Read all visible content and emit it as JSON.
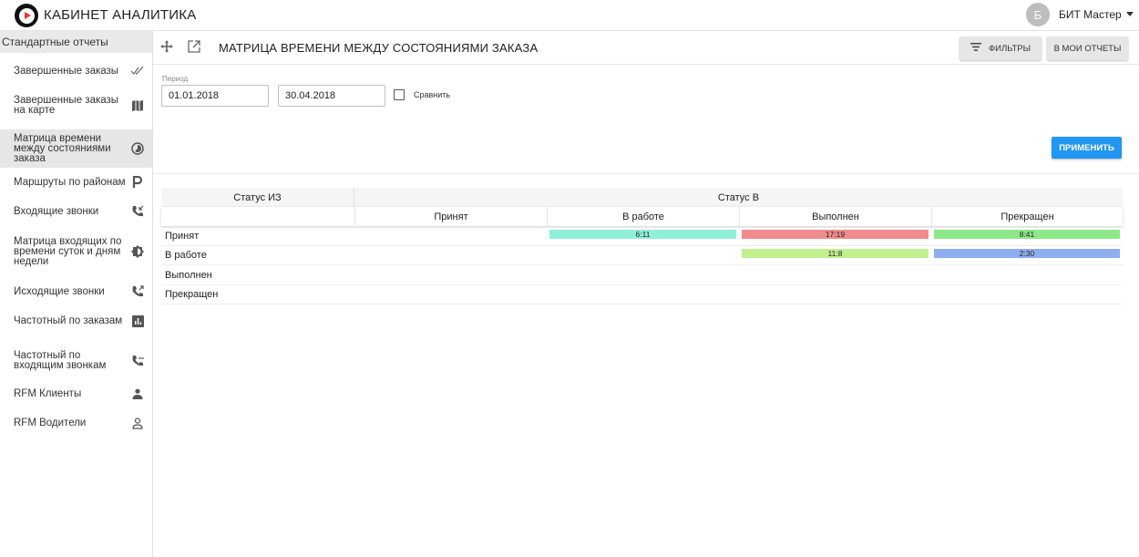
{
  "header": {
    "app_title": "КАБИНЕТ АНАЛИТИКА",
    "avatar_letter": "Б",
    "user_name": "БИТ Мастер"
  },
  "sidebar": {
    "section_title": "Стандартные отчеты",
    "items": [
      {
        "label": "Завершенные заказы",
        "icon": "double-check-icon"
      },
      {
        "label": "Завершенные заказы на карте",
        "icon": "map-icon"
      },
      {
        "label": "Матрица времени между состояниями заказа",
        "icon": "timelapse-icon"
      },
      {
        "label": "Маршруты по районам",
        "icon": "parking-icon"
      },
      {
        "label": "Входящие звонки",
        "icon": "incoming-call-icon"
      },
      {
        "label": "Матрица входящих по времени суток и дням недели",
        "icon": "brightness-icon"
      },
      {
        "label": "Исходящие звонки",
        "icon": "outgoing-call-icon"
      },
      {
        "label": "Частотный по заказам",
        "icon": "bar-chart-icon"
      },
      {
        "label": "Частотный по входящим звонкам",
        "icon": "phone-dots-icon"
      },
      {
        "label": "RFM Клиенты",
        "icon": "person-icon"
      },
      {
        "label": "RFM Водители",
        "icon": "person-outline-icon"
      }
    ]
  },
  "toolbar": {
    "page_title": "МАТРИЦА ВРЕМЕНИ МЕЖДУ СОСТОЯНИЯМИ ЗАКАЗА",
    "filters_label": "ФИЛЬТРЫ",
    "my_reports_label": "В МОИ ОТЧЕТЫ"
  },
  "filters": {
    "period_label": "Период",
    "date_from": "01.01.2018",
    "date_to": "30.04.2018",
    "compare_label": "Сравнить",
    "apply_label": "ПРИМЕНИТЬ"
  },
  "matrix": {
    "status_from_header": "Статус ИЗ",
    "status_to_header": "Статус В",
    "columns": [
      "Принят",
      "В работе",
      "Выполнен",
      "Прекращен"
    ],
    "rows": [
      {
        "label": "Принят",
        "cells": [
          null,
          {
            "value": "6:11",
            "color": "#8ef0d8"
          },
          {
            "value": "17:19",
            "color": "#f08c8c"
          },
          {
            "value": "8:41",
            "color": "#8ee88a"
          }
        ]
      },
      {
        "label": "В работе",
        "cells": [
          null,
          null,
          {
            "value": "11:8",
            "color": "#c2f08e"
          },
          {
            "value": "2:30",
            "color": "#8eaef0"
          }
        ]
      },
      {
        "label": "Выполнен",
        "cells": [
          null,
          null,
          null,
          null
        ]
      },
      {
        "label": "Прекращен",
        "cells": [
          null,
          null,
          null,
          null
        ]
      }
    ]
  }
}
